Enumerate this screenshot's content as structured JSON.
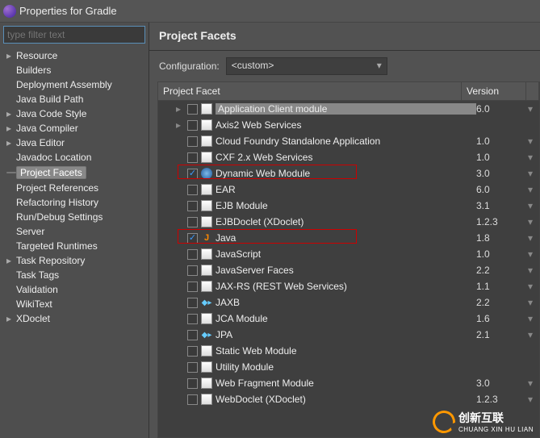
{
  "window": {
    "title": "Properties for Gradle"
  },
  "filter": {
    "placeholder": "type filter text"
  },
  "nav": [
    {
      "label": "Resource",
      "chev": "▸"
    },
    {
      "label": "Builders",
      "chev": ""
    },
    {
      "label": "Deployment Assembly",
      "chev": ""
    },
    {
      "label": "Java Build Path",
      "chev": ""
    },
    {
      "label": "Java Code Style",
      "chev": "▸"
    },
    {
      "label": "Java Compiler",
      "chev": "▸"
    },
    {
      "label": "Java Editor",
      "chev": "▸"
    },
    {
      "label": "Javadoc Location",
      "chev": ""
    },
    {
      "label": "Project Facets",
      "chev": "",
      "selected": true
    },
    {
      "label": "Project References",
      "chev": ""
    },
    {
      "label": "Refactoring History",
      "chev": ""
    },
    {
      "label": "Run/Debug Settings",
      "chev": ""
    },
    {
      "label": "Server",
      "chev": ""
    },
    {
      "label": "Targeted Runtimes",
      "chev": ""
    },
    {
      "label": "Task Repository",
      "chev": "▸"
    },
    {
      "label": "Task Tags",
      "chev": ""
    },
    {
      "label": "Validation",
      "chev": ""
    },
    {
      "label": "WikiText",
      "chev": ""
    },
    {
      "label": "XDoclet",
      "chev": "▸"
    }
  ],
  "page": {
    "title": "Project Facets",
    "config_label": "Configuration:",
    "config_value": "<custom>",
    "columns": {
      "facet": "Project Facet",
      "version": "Version"
    },
    "facets": [
      {
        "label": "Application Client module",
        "version": "6.0",
        "checked": false,
        "icon": "page",
        "selected": true,
        "tree": "▸"
      },
      {
        "label": "Axis2 Web Services",
        "version": "",
        "checked": false,
        "icon": "page",
        "tree": "▸"
      },
      {
        "label": "Cloud Foundry Standalone Application",
        "version": "1.0",
        "checked": false,
        "icon": "page"
      },
      {
        "label": "CXF 2.x Web Services",
        "version": "1.0",
        "checked": false,
        "icon": "page"
      },
      {
        "label": "Dynamic Web Module",
        "version": "3.0",
        "checked": true,
        "icon": "globe",
        "highlight": true
      },
      {
        "label": "EAR",
        "version": "6.0",
        "checked": false,
        "icon": "page"
      },
      {
        "label": "EJB Module",
        "version": "3.1",
        "checked": false,
        "icon": "page"
      },
      {
        "label": "EJBDoclet (XDoclet)",
        "version": "1.2.3",
        "checked": false,
        "icon": "page"
      },
      {
        "label": "Java",
        "version": "1.8",
        "checked": true,
        "icon": "java",
        "highlight": true
      },
      {
        "label": "JavaScript",
        "version": "1.0",
        "checked": false,
        "icon": "page"
      },
      {
        "label": "JavaServer Faces",
        "version": "2.2",
        "checked": false,
        "icon": "page"
      },
      {
        "label": "JAX-RS (REST Web Services)",
        "version": "1.1",
        "checked": false,
        "icon": "page"
      },
      {
        "label": "JAXB",
        "version": "2.2",
        "checked": false,
        "icon": "diamond"
      },
      {
        "label": "JCA Module",
        "version": "1.6",
        "checked": false,
        "icon": "page"
      },
      {
        "label": "JPA",
        "version": "2.1",
        "checked": false,
        "icon": "diamond"
      },
      {
        "label": "Static Web Module",
        "version": "",
        "checked": false,
        "icon": "page"
      },
      {
        "label": "Utility Module",
        "version": "",
        "checked": false,
        "icon": "page"
      },
      {
        "label": "Web Fragment Module",
        "version": "3.0",
        "checked": false,
        "icon": "page"
      },
      {
        "label": "WebDoclet (XDoclet)",
        "version": "1.2.3",
        "checked": false,
        "icon": "page"
      }
    ]
  },
  "logo": {
    "text1": "创新互联",
    "text2": "CHUANG XIN HU LIAN"
  }
}
